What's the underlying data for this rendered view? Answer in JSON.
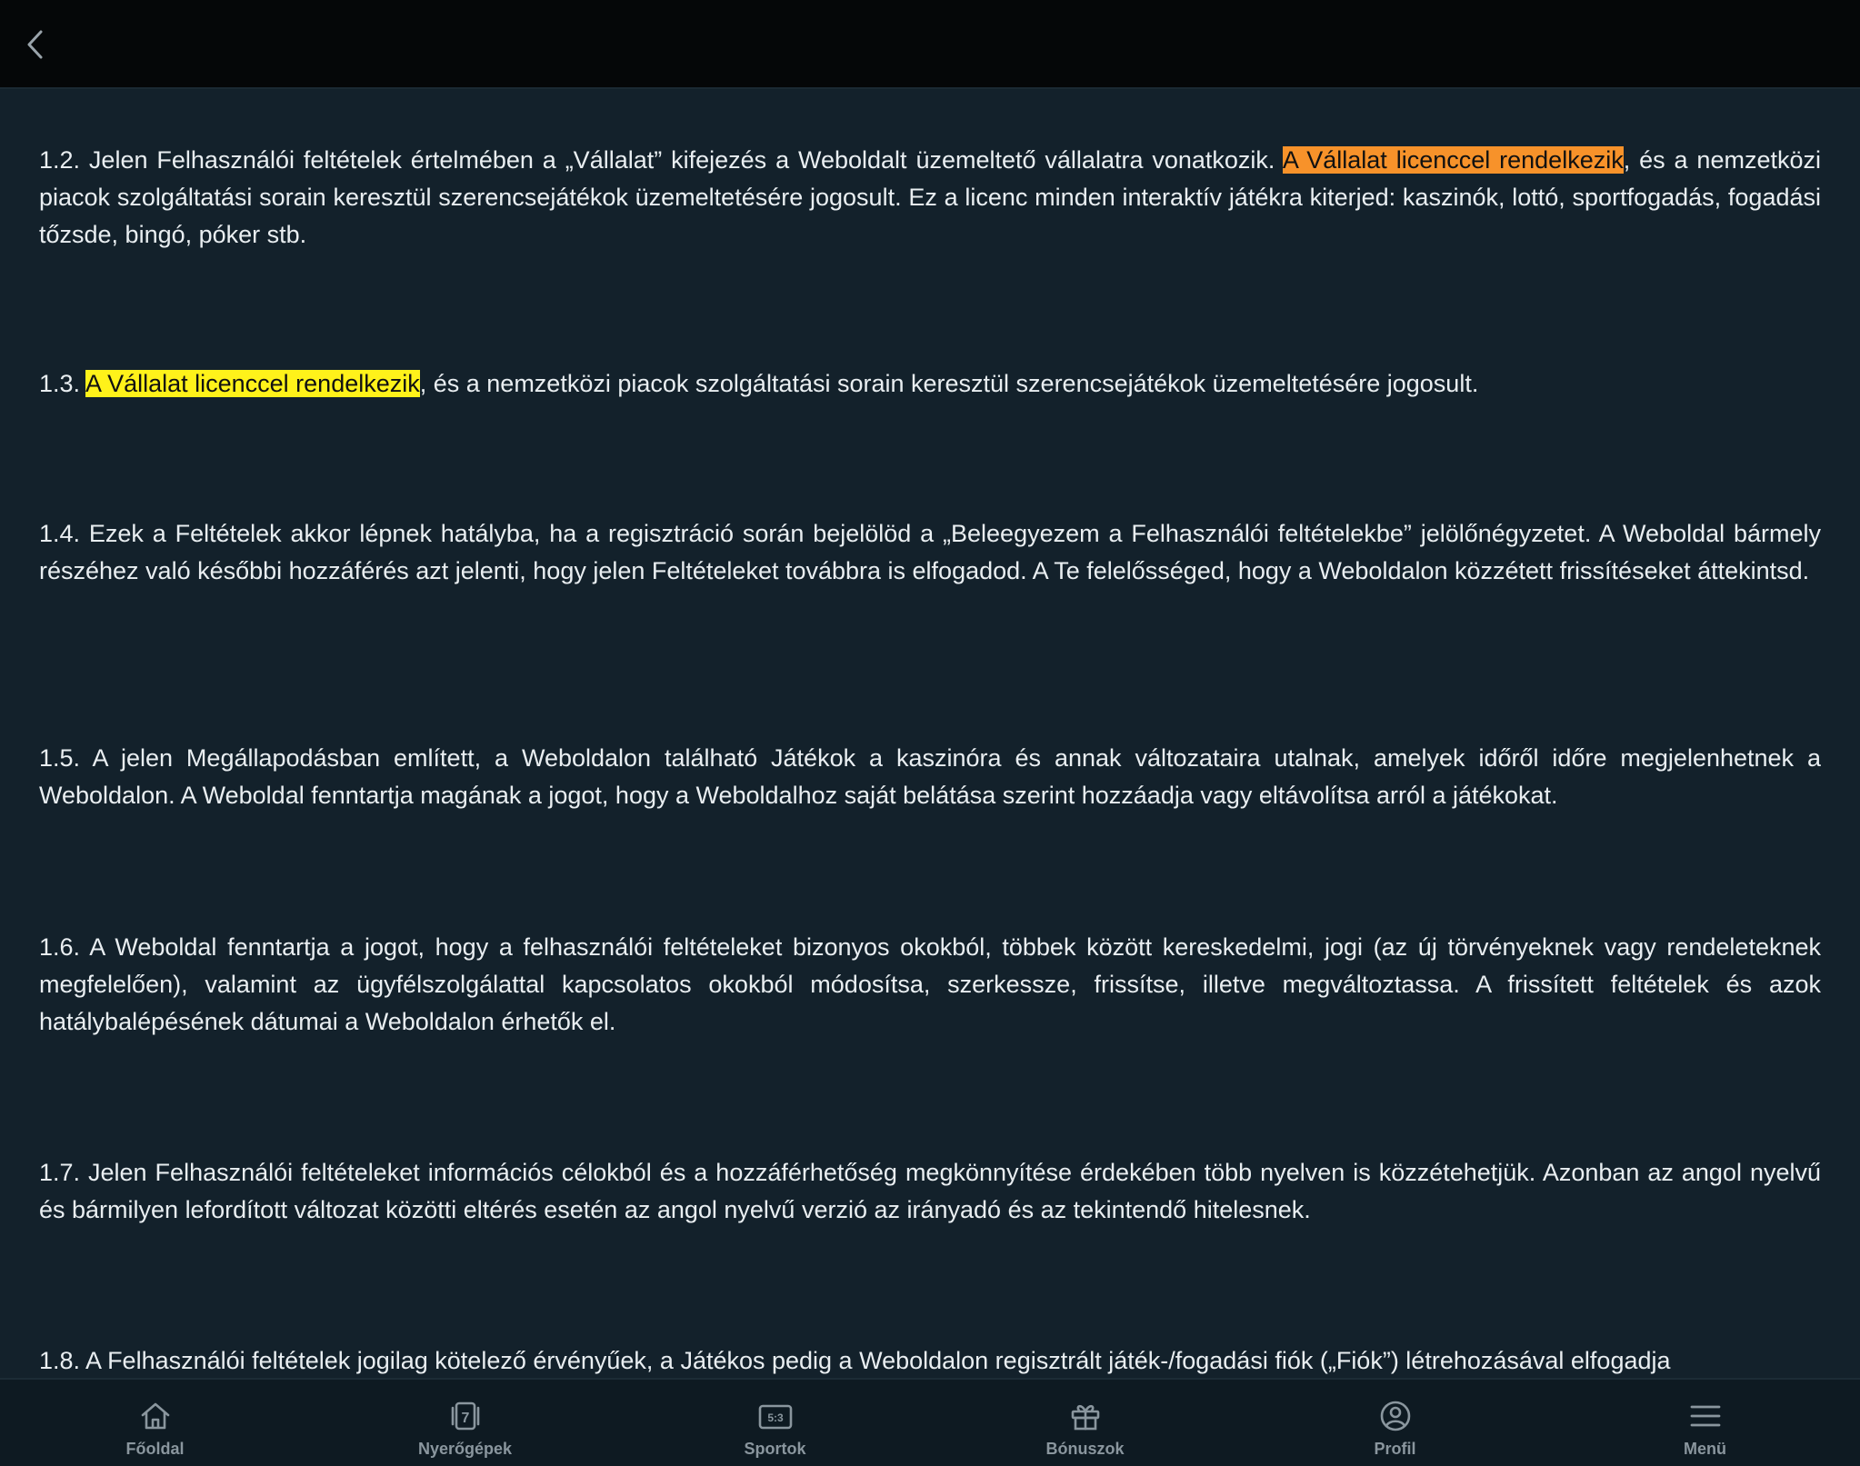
{
  "header": {
    "back_icon": "chevron-left-icon"
  },
  "content": {
    "p12": {
      "before": "1.2. Jelen Felhasználói feltételek értelmében a „Vállalat” kifejezés a Weboldalt üzemeltető vállalatra vonatkozik. ",
      "highlight": "A Vállalat licenccel rendelkezik",
      "after": ", és a nemzetközi piacok szolgáltatási sorain keresztül szerencsejátékok üzemeltetésére jogosult. Ez a licenc minden interaktív játékra kiterjed: kaszinók, lottó, sportfogadás, fogadási tőzsde, bingó, póker stb."
    },
    "p13": {
      "before": "1.3. ",
      "highlight": "A Vállalat licenccel rendelkezik",
      "after": ", és a nemzetközi piacok szolgáltatási sorain keresztül szerencsejátékok üzemeltetésére jogosult."
    },
    "p14": "1.4. Ezek a Feltételek akkor lépnek hatályba, ha a regisztráció során bejelölöd a „Beleegyezem a Felhasználói feltételekbe” jelölőnégyzetet. A Weboldal bármely részéhez való későbbi hozzáférés azt jelenti, hogy jelen Feltételeket továbbra is elfogadod. A Te felelősséged, hogy a Weboldalon közzétett frissítéseket áttekintsd.",
    "p15": "1.5. A jelen Megállapodásban említett, a Weboldalon található Játékok a kaszinóra és annak változataira utalnak, amelyek időről időre megjelenhetnek a Weboldalon. A Weboldal fenntartja magának a jogot, hogy a Weboldalhoz saját belátása szerint hozzáadja vagy eltávolítsa arról a játékokat.",
    "p16": "1.6. A Weboldal fenntartja a jogot, hogy a felhasználói feltételeket bizonyos okokból, többek között kereskedelmi, jogi (az új törvényeknek vagy rendeleteknek megfelelően), valamint az ügyfélszolgálattal kapcsolatos okokból módosítsa, szerkessze, frissítse, illetve megváltoztassa. A frissített feltételek és azok hatálybalépésének dátumai a Weboldalon érhetők el.",
    "p17": "1.7. Jelen Felhasználói feltételeket információs célokból és a hozzáférhetőség megkönnyítése érdekében több nyelven is közzétehetjük. Azonban az angol nyelvű és bármilyen lefordított változat közötti eltérés esetén az angol nyelvű verzió az irányadó és az tekintendő hitelesnek.",
    "p18": "1.8. A Felhasználói feltételek jogilag kötelező érvényűek, a Játékos pedig a Weboldalon regisztrált játék-/fogadási fiók („Fiók”) létrehozásával elfogadja"
  },
  "colors": {
    "background": "#13212b",
    "topbar": "#050708",
    "highlight_orange": "#f7922a",
    "highlight_yellow": "#fff21a",
    "nav_label": "#8a969e"
  },
  "nav": {
    "items": [
      {
        "label": "Főoldal",
        "icon": "home-icon"
      },
      {
        "label": "Nyerőgépek",
        "icon": "slot-machine-icon"
      },
      {
        "label": "Sportok",
        "icon": "scoreboard-icon"
      },
      {
        "label": "Bónuszok",
        "icon": "gift-icon"
      },
      {
        "label": "Profil",
        "icon": "user-circle-icon"
      },
      {
        "label": "Menü",
        "icon": "hamburger-menu-icon"
      }
    ],
    "sports_score": "5:3",
    "slots_digit": "7"
  }
}
